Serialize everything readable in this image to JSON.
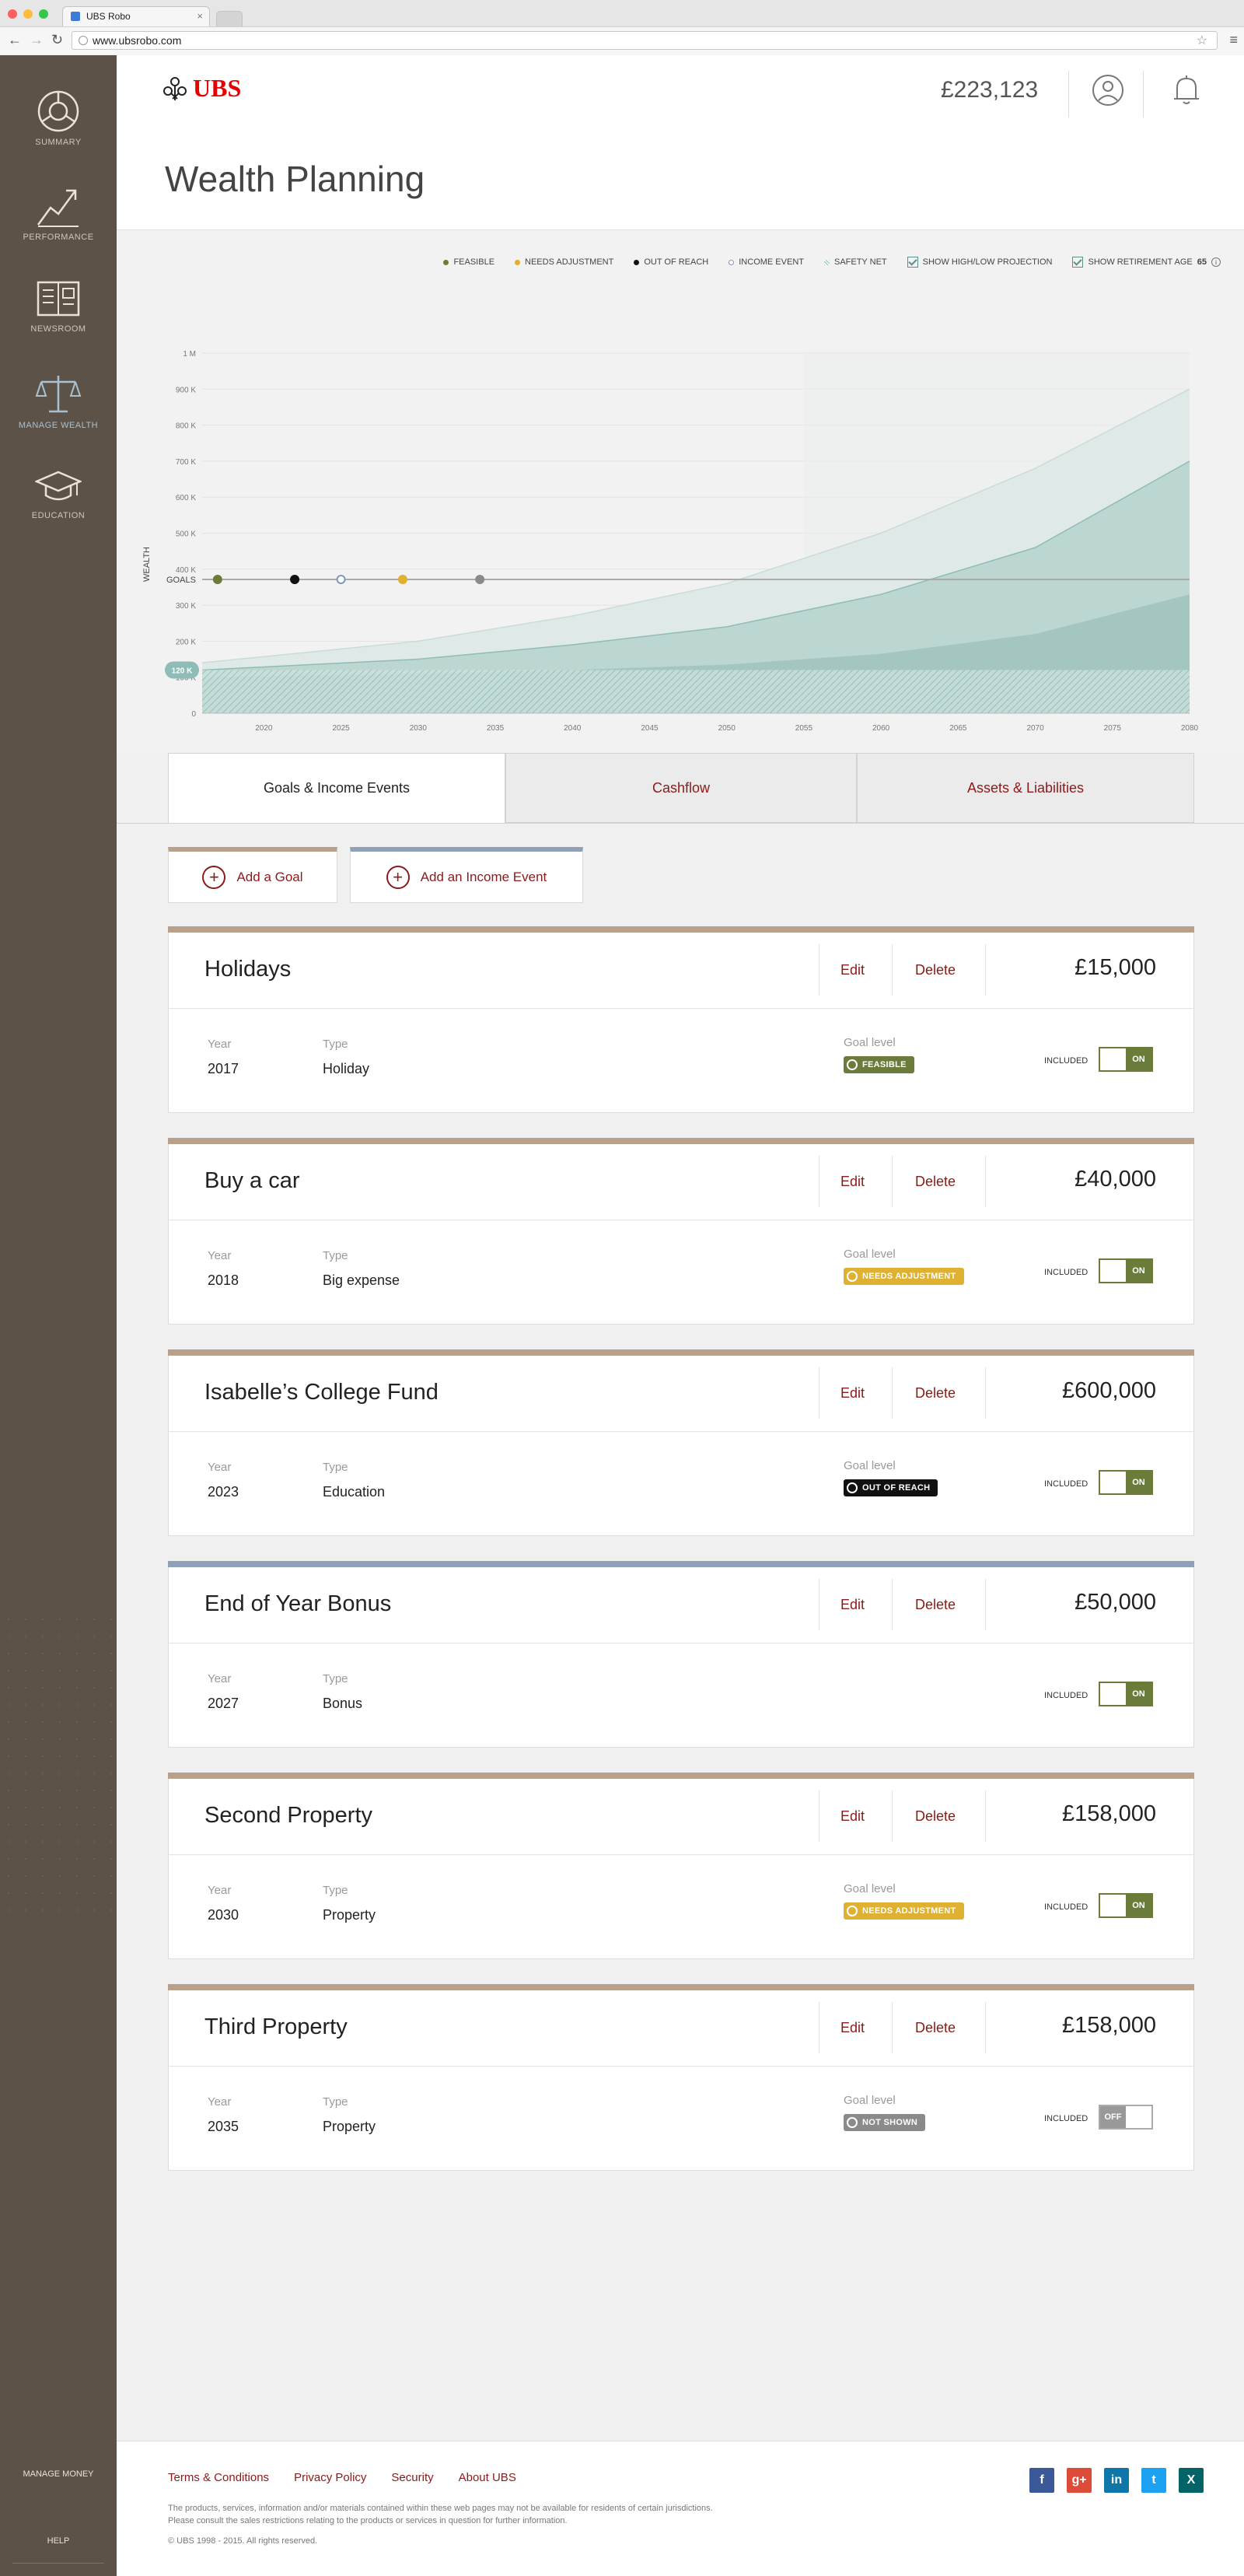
{
  "browser": {
    "tab_title": "UBS Robo",
    "url": "www.ubsrobo.com"
  },
  "sidebar": {
    "items": [
      {
        "label": "SUMMARY",
        "icon": "summary-icon"
      },
      {
        "label": "PERFORMANCE",
        "icon": "performance-icon"
      },
      {
        "label": "NEWSROOM",
        "icon": "newsroom-icon"
      },
      {
        "label": "MANAGE WEALTH",
        "icon": "scales-icon"
      },
      {
        "label": "EDUCATION",
        "icon": "graduation-cap-icon"
      }
    ],
    "bottom": {
      "manage_money": "MANAGE MONEY",
      "help": "HELP"
    }
  },
  "header": {
    "logo_text": "UBS",
    "balance": "£223,123",
    "page_title": "Wealth Planning"
  },
  "legend": {
    "feasible": "FEASIBLE",
    "needs_adjustment": "NEEDS ADJUSTMENT",
    "out_of_reach": "OUT OF REACH",
    "income_event": "INCOME EVENT",
    "safety_net": "SAFETY NET",
    "show_projection": "SHOW HIGH/LOW PROJECTION",
    "show_retirement": "SHOW RETIREMENT AGE",
    "retirement_age": "65"
  },
  "colors": {
    "feasible": "#6b7b3a",
    "needs_adjustment": "#e0b030",
    "out_of_reach": "#111111",
    "income_event": "#7f97b8",
    "not_shown": "#8a8a8a",
    "goal_bar": "#b8a08a",
    "income_bar": "#8fa0b8",
    "accent": "#8b1a1a"
  },
  "chart_data": {
    "type": "area",
    "ylabel": "WEALTH",
    "y_ticks": [
      "0",
      "100 K",
      "200 K",
      "300 K",
      "400 K",
      "500 K",
      "600 K",
      "700 K",
      "800 K",
      "900 K",
      "1 M"
    ],
    "x_ticks": [
      "2020",
      "2025",
      "2030",
      "2035",
      "2040",
      "2045",
      "2050",
      "2055",
      "2060",
      "2065",
      "2070",
      "2075",
      "2080"
    ],
    "ylim": [
      0,
      1000000
    ],
    "xlim": [
      2016,
      2080
    ],
    "current_value_label": "120 K",
    "current_value": 120000,
    "goals_label": "GOALS",
    "goal_markers": [
      {
        "year": 2017,
        "status": "feasible"
      },
      {
        "year": 2022,
        "status": "out_of_reach"
      },
      {
        "year": 2025,
        "status": "income_event"
      },
      {
        "year": 2029,
        "status": "needs_adjustment"
      },
      {
        "year": 2034,
        "status": "not_shown"
      }
    ],
    "series": [
      {
        "name": "high",
        "x": [
          2016,
          2030,
          2040,
          2050,
          2060,
          2070,
          2080
        ],
        "values": [
          140000,
          200000,
          270000,
          360000,
          500000,
          680000,
          900000
        ]
      },
      {
        "name": "expected",
        "x": [
          2016,
          2030,
          2040,
          2050,
          2060,
          2070,
          2080
        ],
        "values": [
          120000,
          150000,
          190000,
          240000,
          330000,
          460000,
          700000
        ]
      },
      {
        "name": "low",
        "x": [
          2016,
          2030,
          2040,
          2050,
          2060,
          2070,
          2080
        ],
        "values": [
          100000,
          110000,
          120000,
          135000,
          165000,
          220000,
          330000
        ]
      },
      {
        "name": "safety net",
        "x": [
          2016,
          2080
        ],
        "values": [
          120000,
          120000
        ]
      }
    ],
    "retirement_year": 2055
  },
  "tabs": [
    {
      "label": "Goals & Income Events",
      "active": true
    },
    {
      "label": "Cashflow",
      "active": false
    },
    {
      "label": "Assets & Liabilities",
      "active": false
    }
  ],
  "actions": {
    "add_goal": "Add a Goal",
    "add_income": "Add an Income Event"
  },
  "labels": {
    "year": "Year",
    "type": "Type",
    "goal_level": "Goal level",
    "included": "INCLUDED",
    "edit": "Edit",
    "delete": "Delete"
  },
  "goals": [
    {
      "title": "Holidays",
      "amount": "£15,000",
      "year": "2017",
      "type": "Holiday",
      "status": "FEASIBLE",
      "status_key": "feasible",
      "kind": "goal",
      "included": "ON"
    },
    {
      "title": "Buy a car",
      "amount": "£40,000",
      "year": "2018",
      "type": "Big expense",
      "status": "NEEDS ADJUSTMENT",
      "status_key": "needs_adjustment",
      "kind": "goal",
      "included": "ON"
    },
    {
      "title": "Isabelle’s College Fund",
      "amount": "£600,000",
      "year": "2023",
      "type": "Education",
      "status": "OUT OF REACH",
      "status_key": "out_of_reach",
      "kind": "goal",
      "included": "ON"
    },
    {
      "title": "End of Year Bonus",
      "amount": "£50,000",
      "year": "2027",
      "type": "Bonus",
      "status": "",
      "status_key": "",
      "kind": "income",
      "included": "ON"
    },
    {
      "title": "Second Property",
      "amount": "£158,000",
      "year": "2030",
      "type": "Property",
      "status": "NEEDS ADJUSTMENT",
      "status_key": "needs_adjustment",
      "kind": "goal",
      "included": "ON"
    },
    {
      "title": "Third Property",
      "amount": "£158,000",
      "year": "2035",
      "type": "Property",
      "status": "NOT SHOWN",
      "status_key": "not_shown",
      "kind": "goal",
      "included": "OFF"
    }
  ],
  "footer": {
    "links": [
      "Terms & Conditions",
      "Privacy Policy",
      "Security",
      "About UBS"
    ],
    "disclaimer": "The products, services, information and/or materials contained within these web pages may not be available for residents of certain jurisdictions. Please consult the sales restrictions relating to the products or services in question for further information.",
    "copyright": "© UBS 1998 - 2015. All rights reserved.",
    "social": [
      {
        "glyph": "f",
        "icon": "facebook-icon",
        "color": "#3b5998"
      },
      {
        "glyph": "g+",
        "icon": "google-plus-icon",
        "color": "#dd4b39"
      },
      {
        "glyph": "in",
        "icon": "linkedin-icon",
        "color": "#0e76a8"
      },
      {
        "glyph": "t",
        "icon": "twitter-icon",
        "color": "#1da1f2"
      },
      {
        "glyph": "X",
        "icon": "xing-icon",
        "color": "#026466"
      }
    ]
  }
}
